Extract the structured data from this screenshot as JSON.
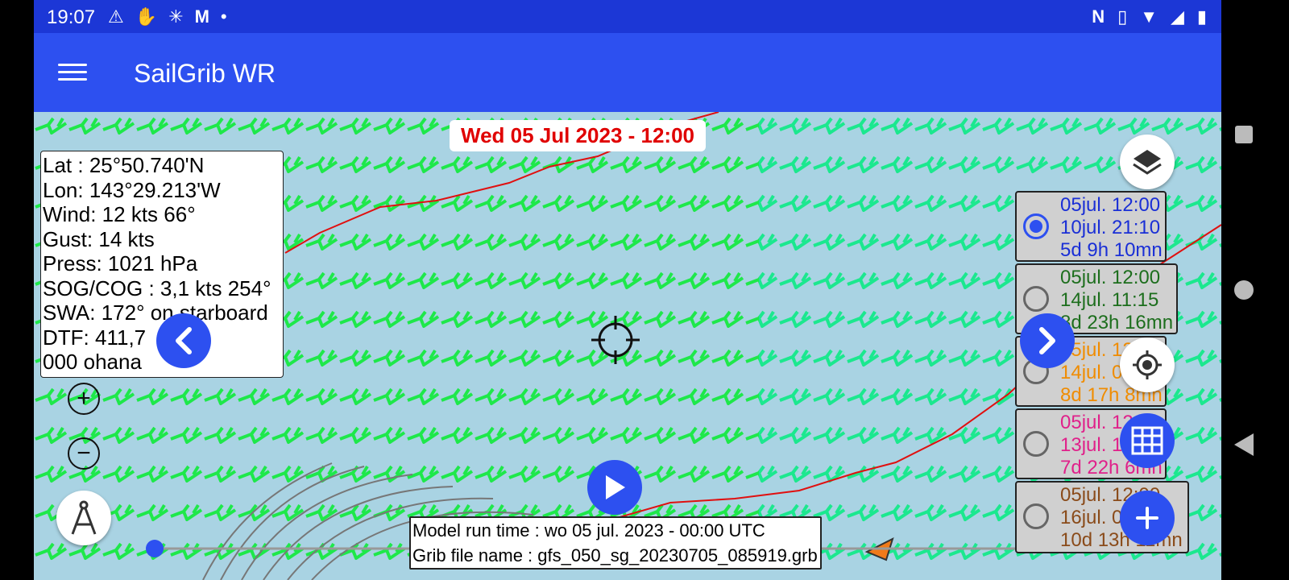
{
  "status_bar": {
    "time": "19:07",
    "left_icons": [
      "warning-icon",
      "hand-icon",
      "network-icon",
      "gmail-icon",
      "dot-icon"
    ],
    "right_icons": [
      "nfc-icon",
      "vibrate-icon",
      "wifi-icon",
      "signal-icon",
      "battery-icon"
    ]
  },
  "app_bar": {
    "title": "SailGrib WR"
  },
  "map": {
    "date_label": "Wed 05 Jul 2023 - 12:00",
    "info": {
      "lat": "Lat :  25°50.740'N",
      "lon": "Lon: 143°29.213'W",
      "wind": "Wind:  12 kts  66°",
      "gust": "Gust:  14 kts",
      "press": "Press: 1021 hPa",
      "sog_cog": "SOG/COG : 3,1 kts 254°",
      "swa": "SWA: 172° on starboard",
      "dtf": "DTF: 411,7",
      "boat": "000 ohana"
    },
    "routes": [
      {
        "line1": "05jul. 12:00",
        "line2": "10jul. 21:10",
        "line3": "5d 9h 10mn",
        "color": "#1a2fd6",
        "selected": true
      },
      {
        "line1": "05jul. 12:00",
        "line2": "14jul. 11:15",
        "line3": "8d 23h 16mn",
        "color": "#1d6e1d",
        "selected": false
      },
      {
        "line1": "05jul. 12:00",
        "line2": "14jul. 05:08",
        "line3": "8d 17h 8mn",
        "color": "#f08c00",
        "selected": false
      },
      {
        "line1": "05jul. 12:00",
        "line2": "13jul. 10:06",
        "line3": "7d 22h 6mn",
        "color": "#e0208a",
        "selected": false
      },
      {
        "line1": "05jul. 12:00",
        "line2": "16jul. 01:11",
        "line3": "10d 13h 11mn",
        "color": "#8a4b1a",
        "selected": false
      }
    ],
    "footer": {
      "model_run": "Model run time : wo 05 jul. 2023 - 00:00 UTC",
      "grib_file": "Grib file name : gfs_050_sg_20230705_085919.grb"
    }
  },
  "icons": {
    "layers": "layers-icon",
    "prev": "chevron-left-icon",
    "next": "chevron-right-icon",
    "locate": "my-location-icon",
    "table": "table-icon",
    "add": "plus-icon",
    "play": "play-icon",
    "compass": "compass-icon",
    "crosshair": "crosshair-icon",
    "zoom_in": "zoom-in-icon",
    "zoom_out": "zoom-out-icon"
  },
  "zoom": {
    "in": "+",
    "out": "−"
  },
  "colors": {
    "accent": "#2d50f0",
    "status_bar": "#1c37d6",
    "sea": "#a9d3e3",
    "route_line": "#e01010",
    "barbs_green": "#1ee84a",
    "barbs_cyan": "#18e8c8"
  }
}
